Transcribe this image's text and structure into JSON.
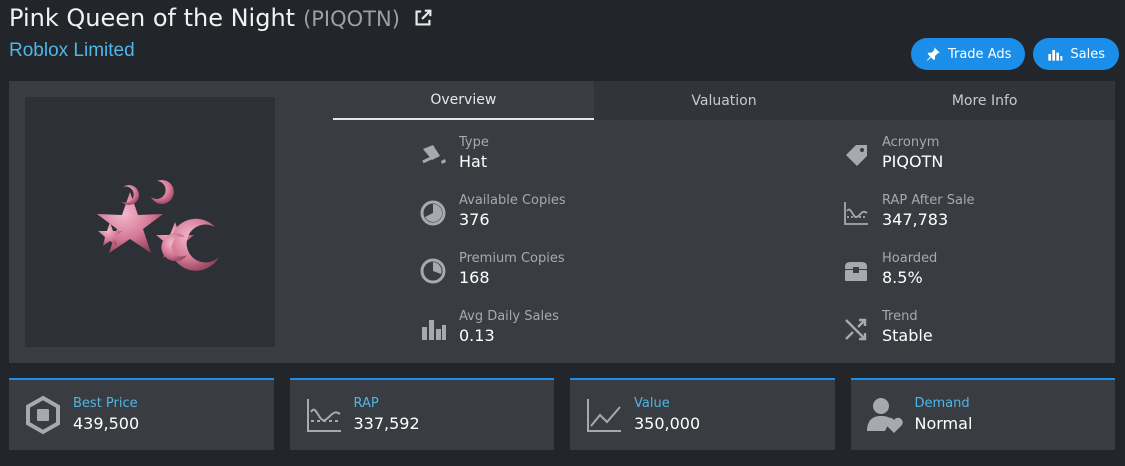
{
  "header": {
    "title": "Pink Queen of the Night",
    "acronym": "(PIQOTN)",
    "subtitle": "Roblox Limited",
    "trade_ads_label": "Trade Ads",
    "sales_label": "Sales"
  },
  "tabs": [
    {
      "label": "Overview"
    },
    {
      "label": "Valuation"
    },
    {
      "label": "More Info"
    }
  ],
  "stats": {
    "left": [
      {
        "label": "Type",
        "value": "Hat",
        "icon": "hat-icon"
      },
      {
        "label": "Available Copies",
        "value": "376",
        "icon": "pie-chart-icon"
      },
      {
        "label": "Premium Copies",
        "value": "168",
        "icon": "pie-chart-icon"
      },
      {
        "label": "Avg Daily Sales",
        "value": "0.13",
        "icon": "bar-chart-icon"
      }
    ],
    "right": [
      {
        "label": "Acronym",
        "value": "PIQOTN",
        "icon": "tag-icon"
      },
      {
        "label": "RAP After Sale",
        "value": "347,783",
        "icon": "curve-chart-icon"
      },
      {
        "label": "Hoarded",
        "value": "8.5%",
        "icon": "chest-icon"
      },
      {
        "label": "Trend",
        "value": "Stable",
        "icon": "shuffle-icon"
      }
    ]
  },
  "cards": [
    {
      "label": "Best Price",
      "value": "439,500",
      "icon": "robux-icon"
    },
    {
      "label": "RAP",
      "value": "337,592",
      "icon": "curve-chart-icon"
    },
    {
      "label": "Value",
      "value": "350,000",
      "icon": "line-chart-icon"
    },
    {
      "label": "Demand",
      "value": "Normal",
      "icon": "user-heart-icon"
    }
  ],
  "colors": {
    "accent": "#1a8ee8",
    "subtitle": "#4fb6e8",
    "panel": "#393c41",
    "background": "#22252a"
  }
}
